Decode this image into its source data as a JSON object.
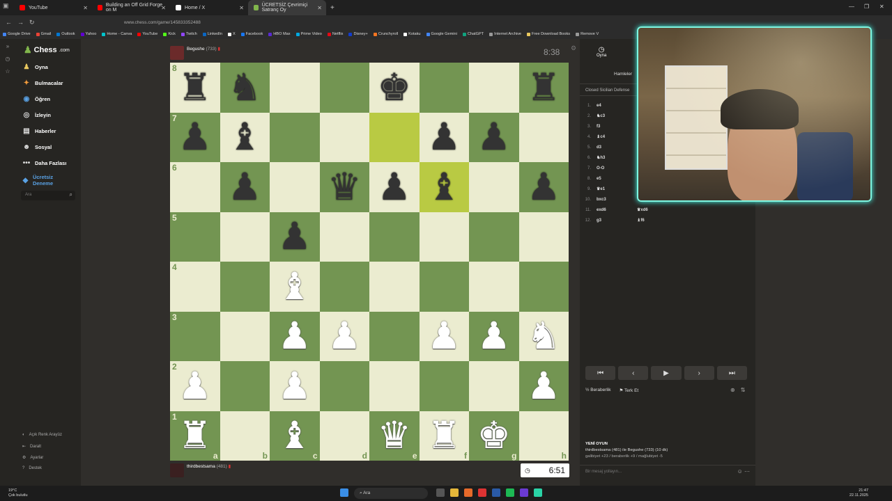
{
  "browser": {
    "tabs": [
      {
        "label": "YouTube",
        "color": "#ff0000",
        "active": false
      },
      {
        "label": "Building an Off Grid Forge on M",
        "color": "#ff0000",
        "active": false
      },
      {
        "label": "Home / X",
        "color": "#ffffff",
        "active": false
      },
      {
        "label": "ÜCRETSİZ Çevrimiçi Satranç Oy",
        "color": "#81b64c",
        "active": true
      }
    ],
    "url": "www.chess.com/game/145833352488",
    "bookmarks": [
      "Google Drive",
      "Gmail",
      "Outlook",
      "Yahoo",
      "Home - Canva",
      "YouTube",
      "Kick",
      "Twitch",
      "LinkedIn",
      "X",
      "Facebook",
      "HBO Max",
      "Prime Video",
      "Netflix",
      "Disney+",
      "Crunchyroll",
      "Kotaku",
      "Google Gemini",
      "ChatGPT",
      "Internet Archive",
      "Free Download Books",
      "Remove V"
    ]
  },
  "sidebar": {
    "logo": "Chess",
    "logo_suffix": ".com",
    "items": [
      {
        "label": "Oyna",
        "icon": "play-icon"
      },
      {
        "label": "Bulmacalar",
        "icon": "puzzle-icon"
      },
      {
        "label": "Öğren",
        "icon": "learn-icon"
      },
      {
        "label": "İzleyin",
        "icon": "watch-icon"
      },
      {
        "label": "Haberler",
        "icon": "news-icon"
      },
      {
        "label": "Sosyal",
        "icon": "social-icon"
      },
      {
        "label": "Daha Fazlası",
        "icon": "more-icon"
      },
      {
        "label": "Ücretsiz Deneme",
        "icon": "diamond-icon"
      }
    ],
    "search_placeholder": "Ara",
    "bottom": [
      "Açık Renk Arayüz",
      "Daralt",
      "Ayarlar",
      "Destek"
    ]
  },
  "game": {
    "top_player": {
      "name": "Begushe",
      "rating": "(733)"
    },
    "top_clock": "8:38",
    "bottom_player": {
      "name": "thirdbestsama",
      "rating": "(481)"
    },
    "bottom_clock": "6:51",
    "ranks": [
      "8",
      "7",
      "6",
      "5",
      "4",
      "3",
      "2",
      "1"
    ],
    "files": [
      "a",
      "b",
      "c",
      "d",
      "e",
      "f",
      "g",
      "h"
    ],
    "board": [
      [
        "bR",
        "bN",
        "",
        "",
        "bK",
        "",
        "",
        "bR"
      ],
      [
        "bP",
        "bB",
        "",
        "",
        "",
        "bP",
        "bP",
        ""
      ],
      [
        "",
        "bP",
        "",
        "bQ",
        "bP",
        "bB",
        "",
        "bP"
      ],
      [
        "",
        "",
        "bP",
        "",
        "",
        "",
        "",
        ""
      ],
      [
        "",
        "",
        "wB",
        "",
        "",
        "",
        "",
        ""
      ],
      [
        "",
        "",
        "wP",
        "wP",
        "",
        "wP",
        "wP",
        "wN"
      ],
      [
        "wP",
        "",
        "wP",
        "",
        "",
        "",
        "",
        "wP"
      ],
      [
        "wR",
        "",
        "wB",
        "",
        "wQ",
        "wR",
        "wK",
        ""
      ]
    ],
    "highlights": [
      "e7",
      "f6"
    ]
  },
  "panel": {
    "tab_label": "Oyna",
    "moves_label": "Hamleler",
    "opening": "Closed Sicilian Defense",
    "moves": [
      {
        "n": "1.",
        "w": "e4",
        "b": ""
      },
      {
        "n": "2.",
        "w": "♞c3",
        "b": ""
      },
      {
        "n": "3.",
        "w": "f3",
        "b": ""
      },
      {
        "n": "4.",
        "w": "♝c4",
        "b": ""
      },
      {
        "n": "5.",
        "w": "d3",
        "b": ""
      },
      {
        "n": "6.",
        "w": "♞h3",
        "b": ""
      },
      {
        "n": "7.",
        "w": "O-O",
        "b": ""
      },
      {
        "n": "8.",
        "w": "e5",
        "b": ""
      },
      {
        "n": "9.",
        "w": "♛e1",
        "b": ""
      },
      {
        "n": "10.",
        "w": "bxc3",
        "b": ""
      },
      {
        "n": "11.",
        "w": "exd6",
        "b": "♛xd6"
      },
      {
        "n": "12.",
        "w": "g3",
        "b": "♝f6"
      }
    ],
    "draw_label": "Beraberlik",
    "resign_label": "Terk Et",
    "new_game_title": "YENİ OYUN",
    "new_game_desc": "thirdbestsama (481) ile Begushe (733) (10 dk)",
    "new_game_stats": "galibiyet +23 / beraberlik +9 / mağlubiyet -5",
    "chat_placeholder": "Bir mesaj yollayın..."
  },
  "taskbar": {
    "weather_temp": "19°C",
    "weather_desc": "Çok bulutlu",
    "search": "Ara",
    "time": "21:47",
    "date": "22.11.2025"
  }
}
